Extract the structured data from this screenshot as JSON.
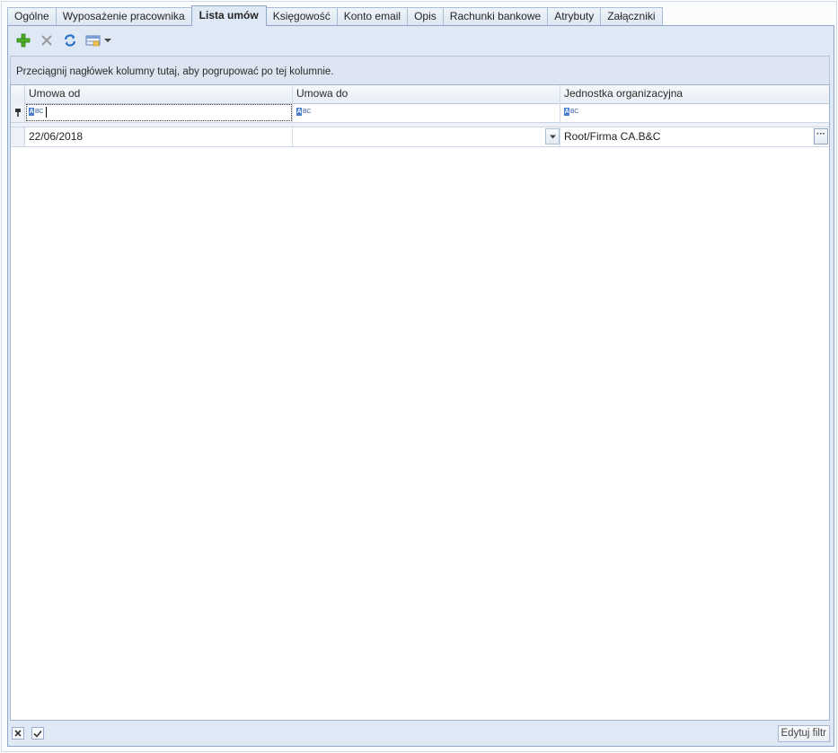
{
  "tabs": [
    {
      "label": "Ogólne",
      "active": false
    },
    {
      "label": "Wyposażenie pracownika",
      "active": false
    },
    {
      "label": "Lista umów",
      "active": true
    },
    {
      "label": "Księgowość",
      "active": false
    },
    {
      "label": "Konto email",
      "active": false
    },
    {
      "label": "Opis",
      "active": false
    },
    {
      "label": "Rachunki bankowe",
      "active": false
    },
    {
      "label": "Atrybuty",
      "active": false
    },
    {
      "label": "Załączniki",
      "active": false
    }
  ],
  "toolbar": {
    "add_icon": "plus-icon",
    "delete_icon": "delete-x-icon",
    "refresh_icon": "refresh-icon",
    "view_icon": "grid-view-icon",
    "accent_add": "#4caf28",
    "accent_refresh": "#2c72c7"
  },
  "group_panel": {
    "text": "Przeciągnij nagłówek kolumny tutaj, aby pogrupować po tej kolumnie."
  },
  "grid": {
    "columns": [
      "Umowa od",
      "Umowa do",
      "Jednostka organizacyjna"
    ],
    "filter_icon_text": "ABC",
    "rows": [
      {
        "umowa_od": "22/06/2018",
        "umowa_do": "",
        "jednostka": "Root/Firma CA.B&C"
      }
    ]
  },
  "footer": {
    "edit_filter_label": "Edytuj filtr"
  }
}
